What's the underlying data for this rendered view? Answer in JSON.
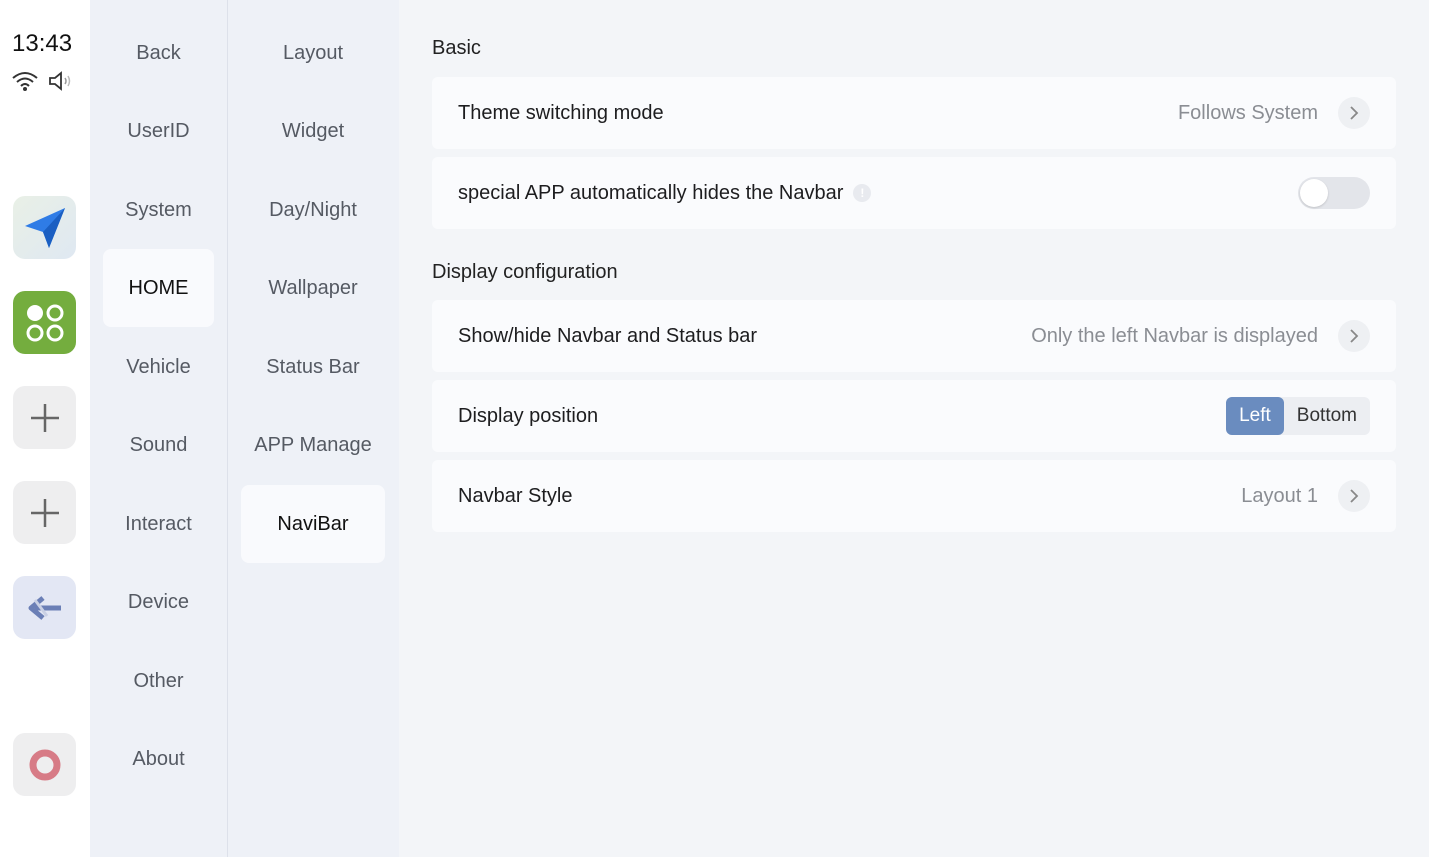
{
  "status": {
    "time": "13:43"
  },
  "dock": {
    "apps": [
      "navigation-app-icon",
      "apps-grid-icon",
      "add-icon",
      "add-icon",
      "back-arrow-icon",
      "ring-app-icon"
    ]
  },
  "categories": {
    "active": "HOME",
    "items": [
      "Back",
      "UserID",
      "System",
      "HOME",
      "Vehicle",
      "Sound",
      "Interact",
      "Device",
      "Other",
      "About"
    ]
  },
  "subcategories": {
    "active": "NaviBar",
    "items": [
      "Layout",
      "Widget",
      "Day/Night",
      "Wallpaper",
      "Status Bar",
      "APP Manage",
      "NaviBar"
    ]
  },
  "main": {
    "basic_title": "Basic",
    "theme": {
      "label": "Theme switching mode",
      "value": "Follows System"
    },
    "auto_hide": {
      "label": "special APP automatically hides the Navbar",
      "enabled": false
    },
    "display_title": "Display configuration",
    "show_hide": {
      "label": "Show/hide Navbar and Status bar",
      "value": "Only the left Navbar is displayed"
    },
    "position": {
      "label": "Display position",
      "options": [
        "Left",
        "Bottom"
      ],
      "selected": "Left"
    },
    "style": {
      "label": "Navbar Style",
      "value": "Layout 1"
    }
  },
  "colors": {
    "accent": "#6a8cbf",
    "background": "#eef1f7"
  }
}
